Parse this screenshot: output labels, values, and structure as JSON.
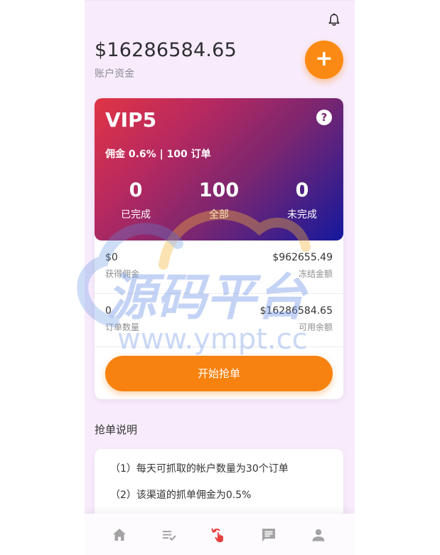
{
  "header": {
    "balance": "$16286584.65",
    "balance_label": "账户资金",
    "add_label": "+"
  },
  "vip": {
    "level": "VIP5",
    "help": "?",
    "subtitle": "佣金 0.6% | 100 订单",
    "stats": [
      {
        "value": "0",
        "label": "已完成"
      },
      {
        "value": "100",
        "label": "全部"
      },
      {
        "value": "0",
        "label": "未完成"
      }
    ]
  },
  "details": {
    "rows": [
      {
        "left_value": "$0",
        "left_label": "获得佣金",
        "right_value": "$962655.49",
        "right_label": "冻结金额"
      },
      {
        "left_value": "0",
        "left_label": "订单数量",
        "right_value": "$16286584.65",
        "right_label": "可用余额"
      }
    ],
    "button_label": "开始抢单"
  },
  "instructions": {
    "title": "抢单说明",
    "items": [
      "（1）每天可抓取的帐户数量为30个订单",
      "（2）该渠道的抓单佣金为0.5%"
    ]
  },
  "watermark": {
    "title": "源码平台",
    "url": "www.ympt.cc"
  },
  "tabs": [
    {
      "icon": "home-icon"
    },
    {
      "icon": "order-list-icon"
    },
    {
      "icon": "grab-order-icon"
    },
    {
      "icon": "message-icon"
    },
    {
      "icon": "user-icon"
    }
  ],
  "colors": {
    "accent": "#f7820f",
    "active_tab": "#e8403f",
    "inactive_tab": "#a3a3a3"
  }
}
